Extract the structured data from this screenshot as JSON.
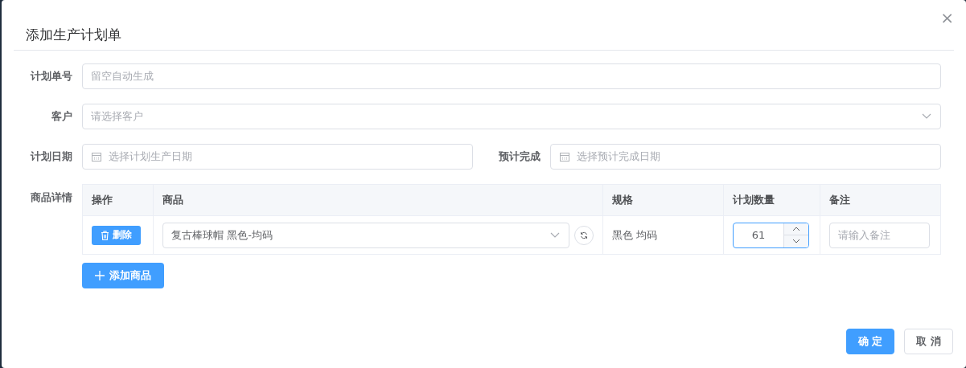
{
  "dialog": {
    "title": "添加生产计划单",
    "close": "×"
  },
  "fields": [
    {
      "kind": "text",
      "label": "计划单号",
      "placeholder": "留空自动生成"
    },
    {
      "kind": "select",
      "label": "客户",
      "placeholder": "请选择客户"
    }
  ],
  "dates": [
    {
      "label": "计划日期",
      "placeholder": "选择计划生产日期"
    },
    {
      "label": "预计完成",
      "placeholder": "选择预计完成日期"
    }
  ],
  "products": {
    "label": "商品详情",
    "columns": [
      "操作",
      "商品",
      "规格",
      "计划数量",
      "备注"
    ],
    "rows": [
      {
        "delete": "删除",
        "product": "复古棒球帽 黑色-均码",
        "spec": "黑色 均码",
        "quantity": "61",
        "quantity_focused": true,
        "note_placeholder": "请输入备注"
      }
    ],
    "add_button": "添加商品"
  },
  "buttons": [
    {
      "label": "确 定",
      "kind": "primary"
    },
    {
      "label": "取 消",
      "kind": "default"
    }
  ]
}
